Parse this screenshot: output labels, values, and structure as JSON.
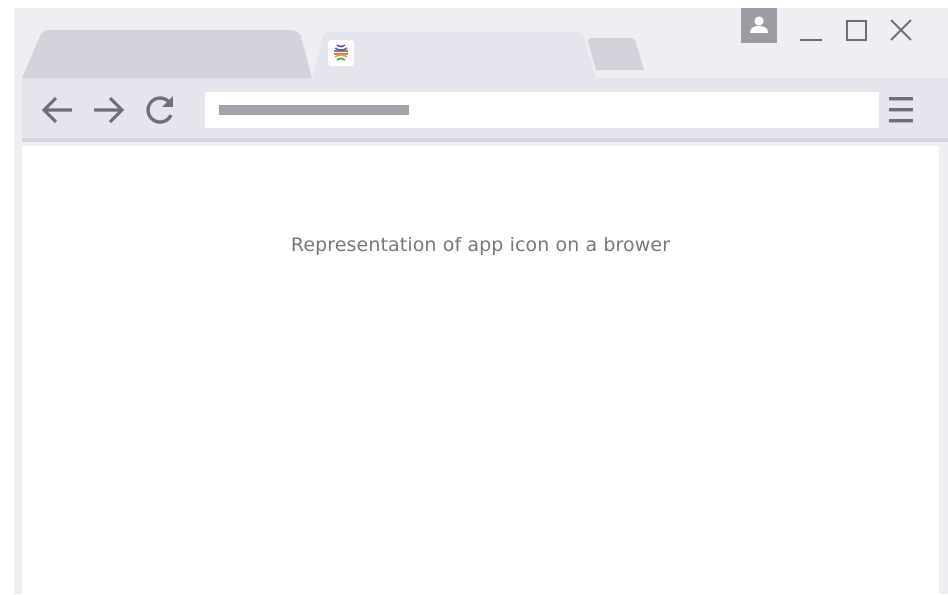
{
  "window": {
    "tabs": [
      {
        "label": "",
        "state": "inactive"
      },
      {
        "label": "",
        "state": "active",
        "favicon": "app-logo-icon"
      }
    ],
    "new_tab_icon": "new-tab-icon",
    "controls": {
      "profile_icon": "user-icon",
      "minimize_icon": "minimize-icon",
      "maximize_icon": "maximize-icon",
      "close_icon": "close-icon"
    }
  },
  "toolbar": {
    "back_icon": "arrow-left-icon",
    "forward_icon": "arrow-right-icon",
    "reload_icon": "reload-icon",
    "address_value": "",
    "menu_icon": "hamburger-menu-icon"
  },
  "content": {
    "caption": "Representation of app icon on a brower"
  },
  "colors": {
    "frame": "#efeff3",
    "tab_inactive": "#d3d3dc",
    "tab_active": "#e5e5ed",
    "icon": "#6e6e76",
    "placeholder_bar": "#a3a3ab",
    "profile_bg": "#9d9ca4",
    "caption_text": "#77777f"
  }
}
